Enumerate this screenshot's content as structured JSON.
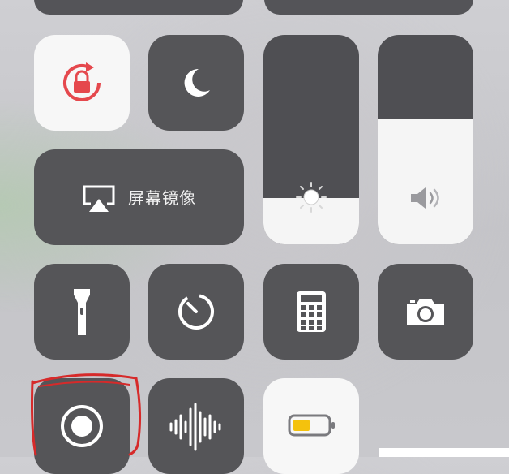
{
  "control_center": {
    "screen_mirroring": {
      "label": "屏幕镜像",
      "icon": "airplay-icon"
    },
    "orientation_lock": {
      "icon": "rotation-lock-icon",
      "state": "on",
      "accent": "#e5484d"
    },
    "do_not_disturb": {
      "icon": "moon-icon",
      "state": "off"
    },
    "brightness": {
      "icon": "sun-icon",
      "level": 0.22
    },
    "volume": {
      "icon": "speaker-icon",
      "level": 0.6
    },
    "flashlight": {
      "icon": "flashlight-icon"
    },
    "timer": {
      "icon": "timer-icon"
    },
    "calculator": {
      "icon": "calculator-icon"
    },
    "camera": {
      "icon": "camera-icon"
    },
    "screen_recording": {
      "icon": "record-icon",
      "highlight_color": "#d62a2a"
    },
    "voice_memos": {
      "icon": "waveform-icon"
    },
    "low_power_mode": {
      "icon": "battery-icon",
      "state": "on",
      "battery_color": "#f4c20d"
    }
  }
}
